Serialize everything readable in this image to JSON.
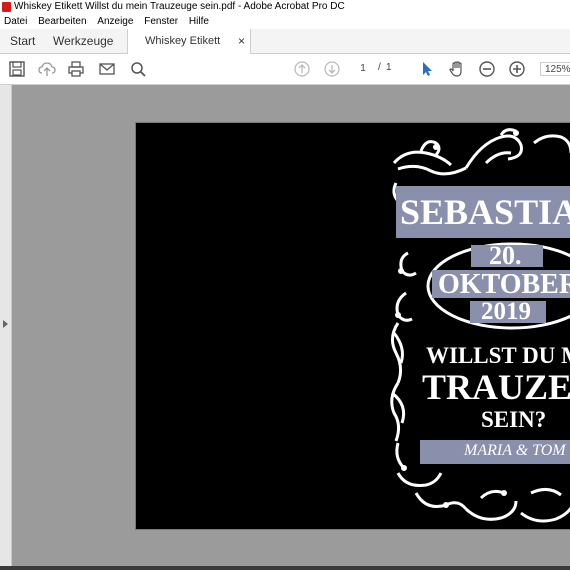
{
  "window": {
    "title": "Whiskey Etikett Willst du mein Trauzeuge sein.pdf - Adobe Acrobat Pro DC"
  },
  "menu": {
    "items": [
      "Datei",
      "Bearbeiten",
      "Anzeige",
      "Fenster",
      "Hilfe"
    ]
  },
  "tabs": {
    "start": "Start",
    "tools": "Werkzeuge",
    "document": "Whiskey Etikett Will...",
    "close": "×"
  },
  "toolbar": {
    "icons": [
      "save-icon",
      "upload-icon",
      "print-icon",
      "mail-icon",
      "search-icon",
      "page-up-icon",
      "page-down-icon",
      "select-cursor-icon",
      "hand-icon",
      "zoom-out-icon",
      "zoom-in-icon"
    ],
    "current_page": "1",
    "page_sep": "/",
    "page_total": "1",
    "zoom": "125%"
  },
  "label": {
    "name": "SEBASTIAN",
    "day": "20.",
    "month": "OKTOBER",
    "year": "2019",
    "line1": "WILLST DU MEIN",
    "line2": "TRAUZEUGE",
    "line3": "SEIN?",
    "signature": "MARIA & TOM",
    "colors": {
      "background": "#000000",
      "banner": "#8a8fab",
      "ornament": "#ffffff"
    }
  }
}
